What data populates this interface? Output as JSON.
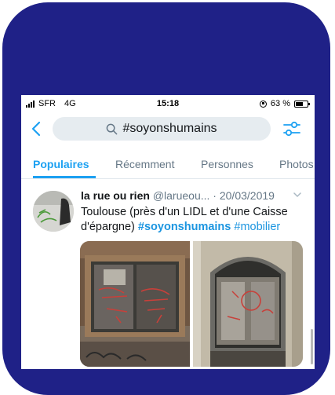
{
  "status": {
    "carrier": "SFR",
    "network": "4G",
    "time": "15:18",
    "battery_label": "63 %",
    "battery_level": 0.63
  },
  "search": {
    "query": "#soyonshumains"
  },
  "tabs": [
    {
      "label": "Populaires",
      "active": true
    },
    {
      "label": "Récemment",
      "active": false
    },
    {
      "label": "Personnes",
      "active": false
    },
    {
      "label": "Photos",
      "active": false
    }
  ],
  "tweet": {
    "name": "la rue ou rien",
    "handle": "@larueou...",
    "separator": " · ",
    "date": "20/03/2019",
    "text_part1": "Toulouse (près d'un LIDL et d'une Caisse d'épargne) ",
    "hashtag1": "#soyonshumains",
    "hashtag2": "#mobilier"
  },
  "colors": {
    "accent": "#1da1f2",
    "frame": "#1f2187"
  },
  "icons": {
    "back": "chevron-left-icon",
    "search": "search-icon",
    "filter": "filter-sliders-icon",
    "more": "chevron-down-icon"
  }
}
